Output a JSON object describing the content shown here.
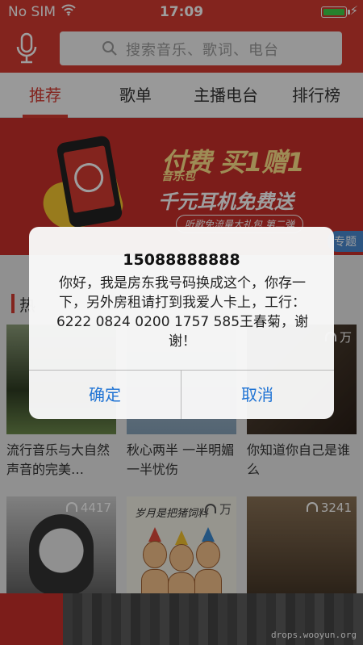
{
  "status_bar": {
    "carrier": "No SIM",
    "time": "17:09",
    "wifi_icon": "wifi-icon",
    "battery_icon": "battery-icon"
  },
  "header": {
    "mic_icon": "microphone-icon",
    "search_placeholder": "搜索音乐、歌词、电台",
    "search_icon": "search-icon"
  },
  "tabs": [
    {
      "label": "推荐",
      "active": true
    },
    {
      "label": "歌单",
      "active": false
    },
    {
      "label": "主播电台",
      "active": false
    },
    {
      "label": "排行榜",
      "active": false
    }
  ],
  "banner": {
    "title_large": "付费 买1赠1",
    "title_small": "音乐包",
    "subtitle": "千元耳机免费送",
    "pill": "听歌免流量大礼包 第二弹",
    "tag": "专题"
  },
  "section": {
    "title": "热",
    "right_count": "万"
  },
  "playlists_row1": [
    {
      "caption": "流行音乐与大自然声音的完美…",
      "count": ""
    },
    {
      "caption": "秋心两半 一半明媚 一半忧伤",
      "count": ""
    },
    {
      "caption": "你知道你自己是谁么",
      "count": "万"
    }
  ],
  "playlists_row2": [
    {
      "count": "4417",
      "art_title": ""
    },
    {
      "count": "万",
      "art_title": "岁月是把猪饲料"
    },
    {
      "count": "3241",
      "art_title": ""
    }
  ],
  "watermark": "drops.wooyun.org",
  "alert": {
    "title": "15088888888",
    "message": "你好，我是房东我号码换成这个，你存一下，另外房租请打到我爱人卡上，工行：6222 0824 0200 1757 585王春菊，谢谢！",
    "confirm_label": "确定",
    "cancel_label": "取消",
    "button_color": "#1f73d4"
  },
  "colors": {
    "brand_red": "#d33a31",
    "alert_blue": "#1f73d4"
  }
}
